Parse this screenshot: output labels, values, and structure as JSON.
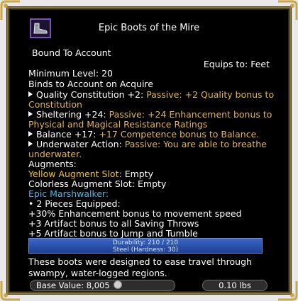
{
  "item": {
    "name": "Epic Boots of the Mire",
    "bound": "Bound To Account",
    "equips_to": "Equips to: Feet",
    "minimum_level": "Minimum Level: 20",
    "binds": "Binds to Account on Acquire"
  },
  "effects": [
    {
      "name": "Quality Constitution +2:",
      "desc_line1": "Passive: +2 Quality bonus to",
      "desc_line2": "Constitution"
    },
    {
      "name": "Sheltering +24:",
      "desc_line1": "Passive: +24 Enhancement bonus to",
      "desc_line2": "Physical and Magical Resistance Ratings"
    },
    {
      "name": "Balance +17:",
      "desc_line1": "+17 Competence bonus to Balance.",
      "desc_line2": ""
    },
    {
      "name": "Underwater Action:",
      "desc_line1": "Passive: You are able to breathe",
      "desc_line2": "underwater."
    }
  ],
  "augments": {
    "header": "Augments:",
    "yellow_label": "Yellow Augment Slot:",
    "yellow_value": "Empty",
    "colorless_label": "Colorless Augment Slot:",
    "colorless_value": "Empty"
  },
  "set": {
    "name": "Epic Marshwalker:",
    "pieces": "• 2 Pieces Equipped:",
    "bonuses": [
      "+30% Enhancement bonus to movement speed",
      "+3 Artifact bonus to all Saving Throws",
      "+5 Artifact bonus to Jump and Tumble"
    ]
  },
  "durability": {
    "line1": "Durability: 210 / 210",
    "line2": "Steel (Hardness: 30)",
    "fraction": 1.0
  },
  "description": "These boots were designed to ease travel through swampy, water-logged regions.",
  "footer": {
    "base_value_label": "Base Value: 8,005",
    "weight": "0.10 lbs"
  },
  "colors": {
    "gold_text": "#e2b74a",
    "yellow_text": "#f2c230",
    "cyan_text": "#4fb8e6",
    "frame": "#8a7531",
    "icon_border": "#7b51b8"
  },
  "icons": {
    "item": "boots-icon",
    "coin": "coin-icon",
    "bullet": "triangle-bullet-icon"
  }
}
